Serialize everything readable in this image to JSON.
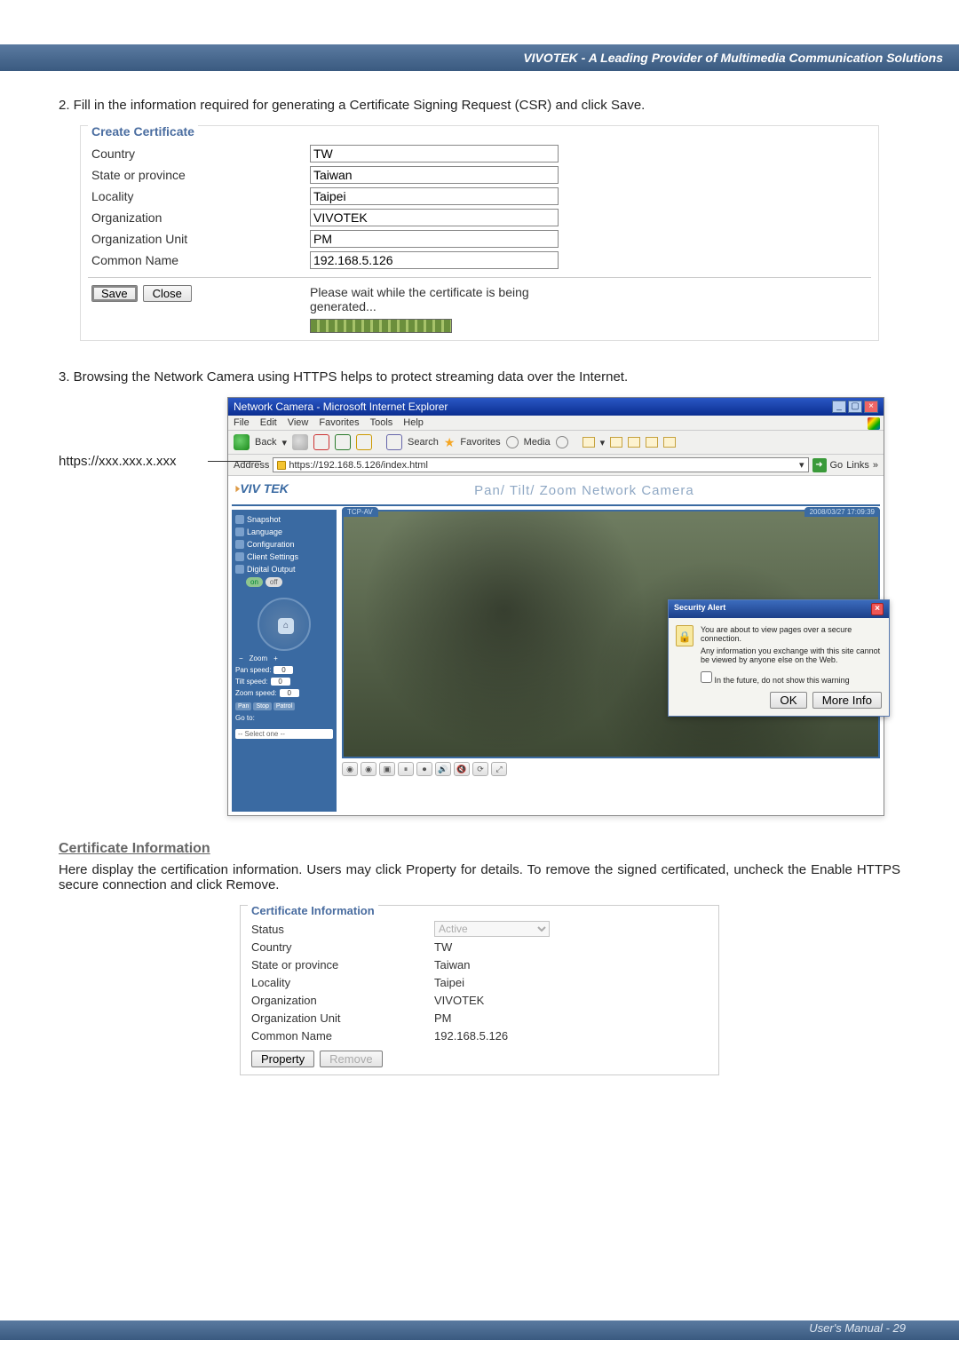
{
  "header": {
    "title": "VIVOTEK - A Leading Provider of Multimedia Communication Solutions"
  },
  "step2": {
    "text": "2. Fill in the information required for generating a Certificate Signing Request (CSR) and click Save.",
    "legend": "Create Certificate",
    "fields": {
      "country_label": "Country",
      "country_val": "TW",
      "state_label": "State or province",
      "state_val": "Taiwan",
      "locality_label": "Locality",
      "locality_val": "Taipei",
      "org_label": "Organization",
      "org_val": "VIVOTEK",
      "ou_label": "Organization Unit",
      "ou_val": "PM",
      "cn_label": "Common Name",
      "cn_val": "192.168.5.126"
    },
    "buttons": {
      "save": "Save",
      "close": "Close"
    },
    "gen_msg_line1": "Please wait while the certificate is being",
    "gen_msg_line2": "generated..."
  },
  "step3": {
    "text": "3. Browsing the Network Camera using HTTPS helps to protect streaming data over the Internet.",
    "annotation": "https://xxx.xxx.x.xxx"
  },
  "browser": {
    "title": "Network Camera - Microsoft Internet Explorer",
    "menu": [
      "File",
      "Edit",
      "View",
      "Favorites",
      "Tools",
      "Help"
    ],
    "toolbar": {
      "back": "Back",
      "search": "Search",
      "favorites": "Favorites",
      "media": "Media"
    },
    "addr_label": "Address",
    "url": "https://192.168.5.126/index.html",
    "go": "Go",
    "links": "Links"
  },
  "cam": {
    "logo": "VIV   TEK",
    "title": "Pan/ Tilt/ Zoom Network Camera",
    "tab": "TCP-AV",
    "timestamp": "2008/03/27 17:09:39",
    "side": {
      "snapshot": "Snapshot",
      "language": "Language",
      "configuration": "Configuration",
      "client_settings": "Client Settings",
      "digital_output": "Digital Output",
      "on": "on",
      "off": "off",
      "zoom": "Zoom",
      "pan_speed": "Pan speed:",
      "pan_val": "0",
      "tilt_speed": "Tilt speed:",
      "tilt_val": "0",
      "zoom_speed": "Zoom speed:",
      "zoom_val": "0",
      "pan": "Pan",
      "stop": "Stop",
      "patrol": "Patrol",
      "goto": "Go to:",
      "goto_opt": "-- Select one --"
    },
    "panel_icons": [
      "◉",
      "◉",
      "▣",
      "⏸",
      "⏺",
      "🔊",
      "🔇",
      "⟳",
      "⤢"
    ]
  },
  "alert": {
    "title": "Security Alert",
    "line1": "You are about to view pages over a secure connection.",
    "line2": "Any information you exchange with this site cannot be viewed by anyone else on the Web.",
    "checkbox": "In the future, do not show this warning",
    "ok": "OK",
    "more": "More Info"
  },
  "cert_info_heading": "Certificate Information",
  "cert_info_intro": "Here display the certification information. Users may click Property for details. To remove the signed certificated, uncheck the Enable HTTPS secure connection and click Remove.",
  "cert_info": {
    "legend": "Certificate Information",
    "status_label": "Status",
    "status_val": "Active",
    "country_label": "Country",
    "country_val": "TW",
    "state_label": "State or province",
    "state_val": "Taiwan",
    "locality_label": "Locality",
    "locality_val": "Taipei",
    "org_label": "Organization",
    "org_val": "VIVOTEK",
    "ou_label": "Organization Unit",
    "ou_val": "PM",
    "cn_label": "Common Name",
    "cn_val": "192.168.5.126",
    "property": "Property",
    "remove": "Remove"
  },
  "footer": {
    "text": "User's Manual - 29"
  }
}
